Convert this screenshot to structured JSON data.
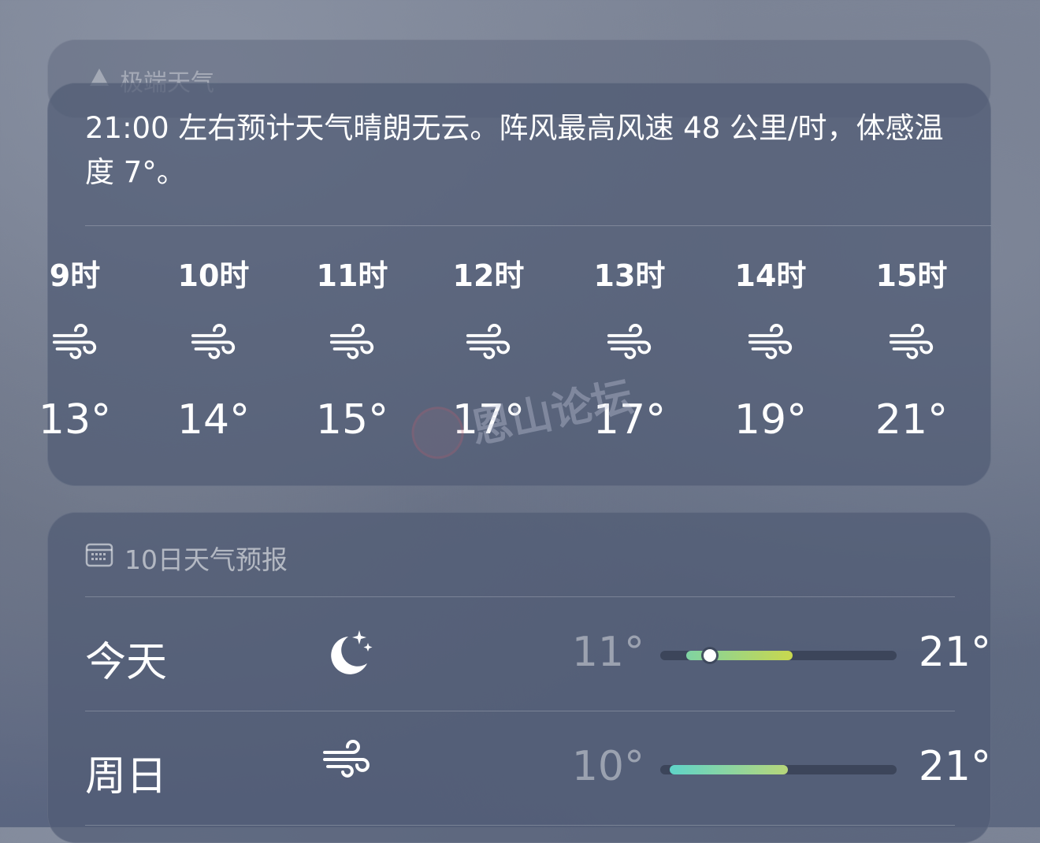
{
  "alert": {
    "label": "极端天气"
  },
  "hourly": {
    "summary": "21:00 左右预计天气晴朗无云。阵风最高风速 48 公里/时，体感温度 7°。",
    "hours": [
      {
        "time": "9时",
        "icon": "wind-icon",
        "temp": "13°"
      },
      {
        "time": "10时",
        "icon": "wind-icon",
        "temp": "14°"
      },
      {
        "time": "11时",
        "icon": "wind-icon",
        "temp": "15°"
      },
      {
        "time": "12时",
        "icon": "wind-icon",
        "temp": "17°"
      },
      {
        "time": "13时",
        "icon": "wind-icon",
        "temp": "17°"
      },
      {
        "time": "14时",
        "icon": "wind-icon",
        "temp": "19°"
      },
      {
        "time": "15时",
        "icon": "wind-icon",
        "temp": "21°"
      }
    ]
  },
  "daily": {
    "header": "10日天气预报",
    "days": [
      {
        "name": "今天",
        "icon": "moon-stars-icon",
        "low": "11°",
        "high": "21°",
        "range_start": 0.11,
        "range_end": 0.56,
        "now": 0.21,
        "colors": [
          "#7fd3a3",
          "#c9d84e"
        ]
      },
      {
        "name": "周日",
        "icon": "wind-icon",
        "low": "10°",
        "high": "21°",
        "range_start": 0.04,
        "range_end": 0.54,
        "colors": [
          "#5fd4c8",
          "#b7d67a"
        ]
      }
    ]
  },
  "watermark": {
    "text": "恩山论坛"
  }
}
